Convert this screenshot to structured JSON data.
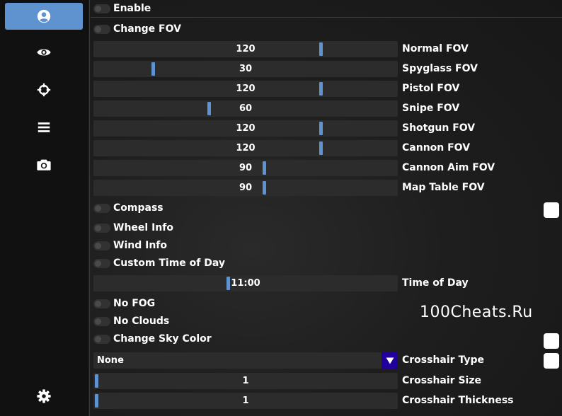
{
  "sidebar": {
    "items": [
      {
        "icon": "user-circle-icon",
        "active": true
      },
      {
        "icon": "eye-icon",
        "active": false
      },
      {
        "icon": "crosshair-icon",
        "active": false
      },
      {
        "icon": "list-icon",
        "active": false
      },
      {
        "icon": "camera-icon",
        "active": false
      },
      {
        "icon": "gear-icon",
        "active": false
      }
    ],
    "accent_color": "#5f93cf"
  },
  "options": {
    "enable": "Enable",
    "change_fov": "Change FOV",
    "compass": "Compass",
    "wheel_info": "Wheel Info",
    "wind_info": "Wind Info",
    "custom_time": "Custom Time of Day",
    "no_fog": "No FOG",
    "no_clouds": "No Clouds",
    "change_sky_color": "Change Sky Color"
  },
  "sliders": {
    "normal_fov": {
      "label": "Normal FOV",
      "value": "120",
      "fraction": 0.75
    },
    "spyglass_fov": {
      "label": "Spyglass FOV",
      "value": "30",
      "fraction": 0.19
    },
    "pistol_fov": {
      "label": "Pistol FOV",
      "value": "120",
      "fraction": 0.75
    },
    "snipe_fov": {
      "label": "Snipe FOV",
      "value": "60",
      "fraction": 0.375
    },
    "shotgun_fov": {
      "label": "Shotgun FOV",
      "value": "120",
      "fraction": 0.75
    },
    "cannon_fov": {
      "label": "Cannon FOV",
      "value": "120",
      "fraction": 0.75
    },
    "cannon_aim_fov": {
      "label": "Cannon Aim FOV",
      "value": "90",
      "fraction": 0.56
    },
    "map_table_fov": {
      "label": "Map Table FOV",
      "value": "90",
      "fraction": 0.56
    },
    "time_of_day": {
      "label": "Time of Day",
      "value": "11:00",
      "fraction": 0.44
    },
    "crosshair_size": {
      "label": "Crosshair Size",
      "value": "1",
      "fraction": 0.0
    },
    "crosshair_thickness": {
      "label": "Crosshair Thickness",
      "value": "1",
      "fraction": 0.0
    }
  },
  "crosshair_type": {
    "label": "Crosshair Type",
    "value": "None"
  },
  "colors": {
    "arrow_button": "#22009e",
    "swatch": "#ffffff"
  },
  "watermark": "100Cheats.Ru"
}
